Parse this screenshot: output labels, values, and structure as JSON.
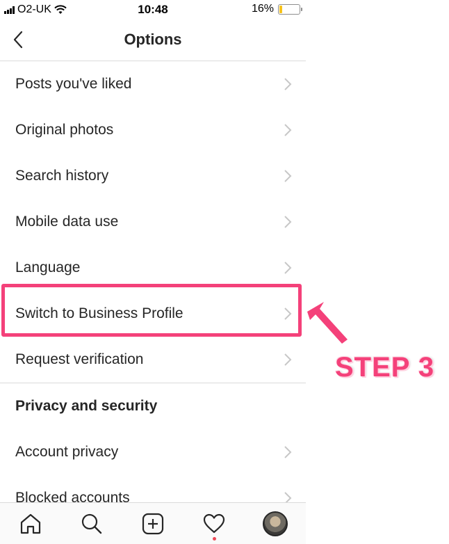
{
  "status": {
    "carrier": "O2-UK",
    "time": "10:48",
    "battery": "16%",
    "battery_level": 16
  },
  "header": {
    "title": "Options"
  },
  "menu": {
    "items": [
      {
        "label": "Posts you've liked"
      },
      {
        "label": "Original photos"
      },
      {
        "label": "Search history"
      },
      {
        "label": "Mobile data use"
      },
      {
        "label": "Language"
      },
      {
        "label": "Switch to Business Profile"
      },
      {
        "label": "Request verification"
      }
    ],
    "section_title": "Privacy and security",
    "section_items": [
      {
        "label": "Account privacy"
      },
      {
        "label": "Blocked accounts"
      }
    ]
  },
  "tabbar": {
    "icons": [
      "home-icon",
      "search-icon",
      "new-post-icon",
      "activity-heart-icon",
      "profile-avatar"
    ]
  },
  "annotation": {
    "step_label": "STEP 3",
    "accent_color": "#f4417a"
  }
}
